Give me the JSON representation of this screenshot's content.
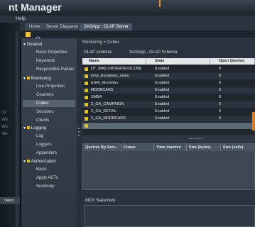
{
  "app": {
    "title": "nt Manager"
  },
  "menu": {
    "help": "Help"
  },
  "left_dock": {
    "labels": [
      "Gr",
      "Wa",
      "Wo",
      "Vie"
    ],
    "bottom_tab": "olders"
  },
  "tabs": [
    {
      "label": "Home",
      "active": false
    },
    {
      "label": "Server Diagrams",
      "active": false
    },
    {
      "label": "SASApp : OLAP Server",
      "active": true
    }
  ],
  "nav": {
    "sections": [
      {
        "label": "General",
        "items": [
          "Basic Properties",
          "Keywords",
          "Responsible Parties"
        ]
      },
      {
        "label": "Monitoring",
        "items": [
          "Live Properties",
          "Counters",
          "Cubes",
          "Sessions",
          "Clients"
        ]
      },
      {
        "label": "Logging",
        "items": [
          "Log",
          "Loggers",
          "Appenders"
        ]
      },
      {
        "label": "Authorization",
        "items": [
          "Basic",
          "Apply ACTs",
          "Summary"
        ]
      }
    ],
    "selected": "Cubes"
  },
  "content": {
    "breadcrumb": "Monitoring > Cubes",
    "schema_label": "OLAP schema:",
    "schema_value": "SASApp - OLAP Schema",
    "cubes_table": {
      "columns": [
        "Name",
        "State",
        "Open Queries"
      ],
      "rows": [
        [
          "DT_MAILORDERINFOCUBE",
          "Enabled",
          "0"
        ],
        [
          "emp_European_sales",
          "Enabled",
          "0"
        ],
        [
          "ESRI_Mcnellan",
          "Enabled",
          "0"
        ],
        [
          "MDDBCARS",
          "Enabled",
          "0"
        ],
        [
          "SMBA",
          "Enabled",
          "0"
        ],
        [
          "Z_GA_CAMPAIGN",
          "Enabled",
          "0"
        ],
        [
          "Z_GA_DETAIL",
          "Enabled",
          "0"
        ],
        [
          "Z_GA_MDDBCARS",
          "Enabled",
          "0"
        ],
        [
          "",
          "",
          ""
        ]
      ]
    },
    "queries_table": {
      "columns": [
        "Queries By Serv...",
        "Cubes",
        "Time Inactive",
        "Size (bytes)",
        "Size (cells)"
      ]
    },
    "mdx_label": "MDX Statement"
  },
  "colors": {
    "accent": "#f08a1c",
    "cube_icon": "#e8c100",
    "header_bg": "#e3e6ea"
  }
}
